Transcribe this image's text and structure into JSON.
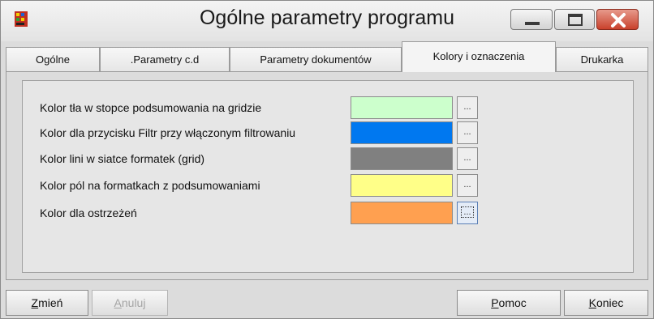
{
  "window": {
    "title": "Ogólne parametry programu"
  },
  "tabs": [
    {
      "label": "Ogólne",
      "active": false
    },
    {
      "label": ".Parametry c.d",
      "active": false
    },
    {
      "label": "Parametry dokumentów",
      "active": false
    },
    {
      "label": "Kolory i oznaczenia",
      "active": true
    },
    {
      "label": "Drukarka",
      "active": false
    }
  ],
  "colors": [
    {
      "label": "Kolor tła w stopce podsumowania na gridzie",
      "color": "#ccffcc",
      "button": "..."
    },
    {
      "label": "Kolor dla przycisku Filtr przy włączonym filtrowaniu",
      "color": "#0078f0",
      "button": "..."
    },
    {
      "label": "Kolor lini w siatce formatek (grid)",
      "color": "#808080",
      "button": "..."
    },
    {
      "label": "Kolor pól na formatkach z podsumowaniami",
      "color": "#ffff88",
      "button": "..."
    },
    {
      "label": "Kolor dla ostrzeżeń",
      "color": "#ffa050",
      "button": "..."
    }
  ],
  "buttons": {
    "zmien": {
      "key": "Z",
      "rest": "mień"
    },
    "anuluj": {
      "key": "A",
      "rest": "nuluj"
    },
    "pomoc": {
      "key": "P",
      "rest": "omoc"
    },
    "koniec": {
      "key": "K",
      "rest": "oniec"
    }
  },
  "icons": {
    "app": "app-icon",
    "minimize": "minimize-icon",
    "maximize": "maximize-icon",
    "close": "close-icon"
  }
}
